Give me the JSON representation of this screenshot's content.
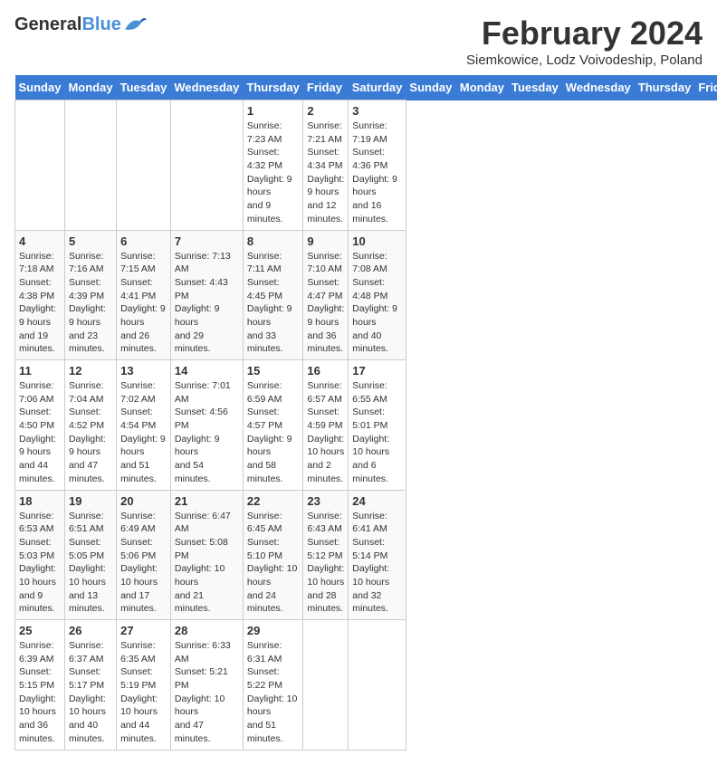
{
  "logo": {
    "text_general": "General",
    "text_blue": "Blue"
  },
  "title": "February 2024",
  "location": "Siemkowice, Lodz Voivodeship, Poland",
  "days_of_week": [
    "Sunday",
    "Monday",
    "Tuesday",
    "Wednesday",
    "Thursday",
    "Friday",
    "Saturday"
  ],
  "weeks": [
    [
      {
        "day": "",
        "info": ""
      },
      {
        "day": "",
        "info": ""
      },
      {
        "day": "",
        "info": ""
      },
      {
        "day": "",
        "info": ""
      },
      {
        "day": "1",
        "info": "Sunrise: 7:23 AM\nSunset: 4:32 PM\nDaylight: 9 hours\nand 9 minutes."
      },
      {
        "day": "2",
        "info": "Sunrise: 7:21 AM\nSunset: 4:34 PM\nDaylight: 9 hours\nand 12 minutes."
      },
      {
        "day": "3",
        "info": "Sunrise: 7:19 AM\nSunset: 4:36 PM\nDaylight: 9 hours\nand 16 minutes."
      }
    ],
    [
      {
        "day": "4",
        "info": "Sunrise: 7:18 AM\nSunset: 4:38 PM\nDaylight: 9 hours\nand 19 minutes."
      },
      {
        "day": "5",
        "info": "Sunrise: 7:16 AM\nSunset: 4:39 PM\nDaylight: 9 hours\nand 23 minutes."
      },
      {
        "day": "6",
        "info": "Sunrise: 7:15 AM\nSunset: 4:41 PM\nDaylight: 9 hours\nand 26 minutes."
      },
      {
        "day": "7",
        "info": "Sunrise: 7:13 AM\nSunset: 4:43 PM\nDaylight: 9 hours\nand 29 minutes."
      },
      {
        "day": "8",
        "info": "Sunrise: 7:11 AM\nSunset: 4:45 PM\nDaylight: 9 hours\nand 33 minutes."
      },
      {
        "day": "9",
        "info": "Sunrise: 7:10 AM\nSunset: 4:47 PM\nDaylight: 9 hours\nand 36 minutes."
      },
      {
        "day": "10",
        "info": "Sunrise: 7:08 AM\nSunset: 4:48 PM\nDaylight: 9 hours\nand 40 minutes."
      }
    ],
    [
      {
        "day": "11",
        "info": "Sunrise: 7:06 AM\nSunset: 4:50 PM\nDaylight: 9 hours\nand 44 minutes."
      },
      {
        "day": "12",
        "info": "Sunrise: 7:04 AM\nSunset: 4:52 PM\nDaylight: 9 hours\nand 47 minutes."
      },
      {
        "day": "13",
        "info": "Sunrise: 7:02 AM\nSunset: 4:54 PM\nDaylight: 9 hours\nand 51 minutes."
      },
      {
        "day": "14",
        "info": "Sunrise: 7:01 AM\nSunset: 4:56 PM\nDaylight: 9 hours\nand 54 minutes."
      },
      {
        "day": "15",
        "info": "Sunrise: 6:59 AM\nSunset: 4:57 PM\nDaylight: 9 hours\nand 58 minutes."
      },
      {
        "day": "16",
        "info": "Sunrise: 6:57 AM\nSunset: 4:59 PM\nDaylight: 10 hours\nand 2 minutes."
      },
      {
        "day": "17",
        "info": "Sunrise: 6:55 AM\nSunset: 5:01 PM\nDaylight: 10 hours\nand 6 minutes."
      }
    ],
    [
      {
        "day": "18",
        "info": "Sunrise: 6:53 AM\nSunset: 5:03 PM\nDaylight: 10 hours\nand 9 minutes."
      },
      {
        "day": "19",
        "info": "Sunrise: 6:51 AM\nSunset: 5:05 PM\nDaylight: 10 hours\nand 13 minutes."
      },
      {
        "day": "20",
        "info": "Sunrise: 6:49 AM\nSunset: 5:06 PM\nDaylight: 10 hours\nand 17 minutes."
      },
      {
        "day": "21",
        "info": "Sunrise: 6:47 AM\nSunset: 5:08 PM\nDaylight: 10 hours\nand 21 minutes."
      },
      {
        "day": "22",
        "info": "Sunrise: 6:45 AM\nSunset: 5:10 PM\nDaylight: 10 hours\nand 24 minutes."
      },
      {
        "day": "23",
        "info": "Sunrise: 6:43 AM\nSunset: 5:12 PM\nDaylight: 10 hours\nand 28 minutes."
      },
      {
        "day": "24",
        "info": "Sunrise: 6:41 AM\nSunset: 5:14 PM\nDaylight: 10 hours\nand 32 minutes."
      }
    ],
    [
      {
        "day": "25",
        "info": "Sunrise: 6:39 AM\nSunset: 5:15 PM\nDaylight: 10 hours\nand 36 minutes."
      },
      {
        "day": "26",
        "info": "Sunrise: 6:37 AM\nSunset: 5:17 PM\nDaylight: 10 hours\nand 40 minutes."
      },
      {
        "day": "27",
        "info": "Sunrise: 6:35 AM\nSunset: 5:19 PM\nDaylight: 10 hours\nand 44 minutes."
      },
      {
        "day": "28",
        "info": "Sunrise: 6:33 AM\nSunset: 5:21 PM\nDaylight: 10 hours\nand 47 minutes."
      },
      {
        "day": "29",
        "info": "Sunrise: 6:31 AM\nSunset: 5:22 PM\nDaylight: 10 hours\nand 51 minutes."
      },
      {
        "day": "",
        "info": ""
      },
      {
        "day": "",
        "info": ""
      }
    ]
  ]
}
